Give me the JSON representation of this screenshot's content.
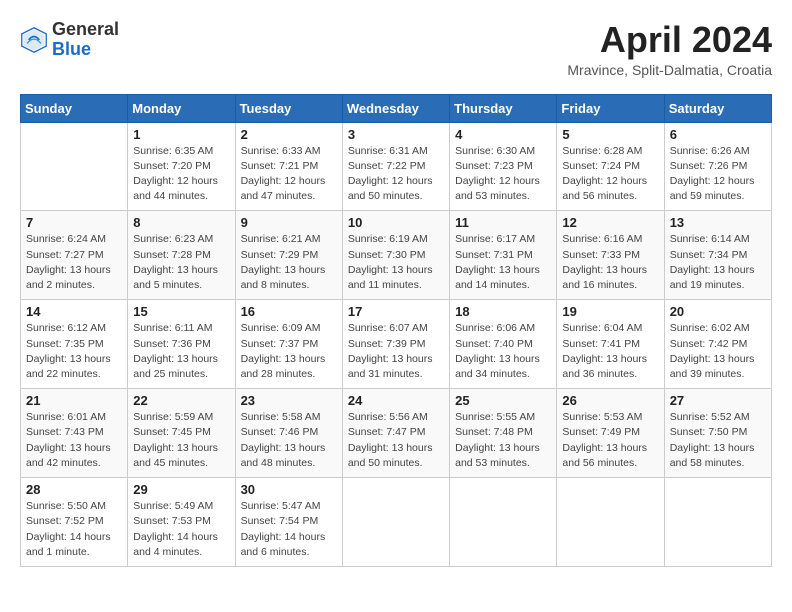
{
  "header": {
    "logo_general": "General",
    "logo_blue": "Blue",
    "month_title": "April 2024",
    "location": "Mravince, Split-Dalmatia, Croatia"
  },
  "weekdays": [
    "Sunday",
    "Monday",
    "Tuesday",
    "Wednesday",
    "Thursday",
    "Friday",
    "Saturday"
  ],
  "weeks": [
    [
      {
        "day": "",
        "info": ""
      },
      {
        "day": "1",
        "info": "Sunrise: 6:35 AM\nSunset: 7:20 PM\nDaylight: 12 hours\nand 44 minutes."
      },
      {
        "day": "2",
        "info": "Sunrise: 6:33 AM\nSunset: 7:21 PM\nDaylight: 12 hours\nand 47 minutes."
      },
      {
        "day": "3",
        "info": "Sunrise: 6:31 AM\nSunset: 7:22 PM\nDaylight: 12 hours\nand 50 minutes."
      },
      {
        "day": "4",
        "info": "Sunrise: 6:30 AM\nSunset: 7:23 PM\nDaylight: 12 hours\nand 53 minutes."
      },
      {
        "day": "5",
        "info": "Sunrise: 6:28 AM\nSunset: 7:24 PM\nDaylight: 12 hours\nand 56 minutes."
      },
      {
        "day": "6",
        "info": "Sunrise: 6:26 AM\nSunset: 7:26 PM\nDaylight: 12 hours\nand 59 minutes."
      }
    ],
    [
      {
        "day": "7",
        "info": "Sunrise: 6:24 AM\nSunset: 7:27 PM\nDaylight: 13 hours\nand 2 minutes."
      },
      {
        "day": "8",
        "info": "Sunrise: 6:23 AM\nSunset: 7:28 PM\nDaylight: 13 hours\nand 5 minutes."
      },
      {
        "day": "9",
        "info": "Sunrise: 6:21 AM\nSunset: 7:29 PM\nDaylight: 13 hours\nand 8 minutes."
      },
      {
        "day": "10",
        "info": "Sunrise: 6:19 AM\nSunset: 7:30 PM\nDaylight: 13 hours\nand 11 minutes."
      },
      {
        "day": "11",
        "info": "Sunrise: 6:17 AM\nSunset: 7:31 PM\nDaylight: 13 hours\nand 14 minutes."
      },
      {
        "day": "12",
        "info": "Sunrise: 6:16 AM\nSunset: 7:33 PM\nDaylight: 13 hours\nand 16 minutes."
      },
      {
        "day": "13",
        "info": "Sunrise: 6:14 AM\nSunset: 7:34 PM\nDaylight: 13 hours\nand 19 minutes."
      }
    ],
    [
      {
        "day": "14",
        "info": "Sunrise: 6:12 AM\nSunset: 7:35 PM\nDaylight: 13 hours\nand 22 minutes."
      },
      {
        "day": "15",
        "info": "Sunrise: 6:11 AM\nSunset: 7:36 PM\nDaylight: 13 hours\nand 25 minutes."
      },
      {
        "day": "16",
        "info": "Sunrise: 6:09 AM\nSunset: 7:37 PM\nDaylight: 13 hours\nand 28 minutes."
      },
      {
        "day": "17",
        "info": "Sunrise: 6:07 AM\nSunset: 7:39 PM\nDaylight: 13 hours\nand 31 minutes."
      },
      {
        "day": "18",
        "info": "Sunrise: 6:06 AM\nSunset: 7:40 PM\nDaylight: 13 hours\nand 34 minutes."
      },
      {
        "day": "19",
        "info": "Sunrise: 6:04 AM\nSunset: 7:41 PM\nDaylight: 13 hours\nand 36 minutes."
      },
      {
        "day": "20",
        "info": "Sunrise: 6:02 AM\nSunset: 7:42 PM\nDaylight: 13 hours\nand 39 minutes."
      }
    ],
    [
      {
        "day": "21",
        "info": "Sunrise: 6:01 AM\nSunset: 7:43 PM\nDaylight: 13 hours\nand 42 minutes."
      },
      {
        "day": "22",
        "info": "Sunrise: 5:59 AM\nSunset: 7:45 PM\nDaylight: 13 hours\nand 45 minutes."
      },
      {
        "day": "23",
        "info": "Sunrise: 5:58 AM\nSunset: 7:46 PM\nDaylight: 13 hours\nand 48 minutes."
      },
      {
        "day": "24",
        "info": "Sunrise: 5:56 AM\nSunset: 7:47 PM\nDaylight: 13 hours\nand 50 minutes."
      },
      {
        "day": "25",
        "info": "Sunrise: 5:55 AM\nSunset: 7:48 PM\nDaylight: 13 hours\nand 53 minutes."
      },
      {
        "day": "26",
        "info": "Sunrise: 5:53 AM\nSunset: 7:49 PM\nDaylight: 13 hours\nand 56 minutes."
      },
      {
        "day": "27",
        "info": "Sunrise: 5:52 AM\nSunset: 7:50 PM\nDaylight: 13 hours\nand 58 minutes."
      }
    ],
    [
      {
        "day": "28",
        "info": "Sunrise: 5:50 AM\nSunset: 7:52 PM\nDaylight: 14 hours\nand 1 minute."
      },
      {
        "day": "29",
        "info": "Sunrise: 5:49 AM\nSunset: 7:53 PM\nDaylight: 14 hours\nand 4 minutes."
      },
      {
        "day": "30",
        "info": "Sunrise: 5:47 AM\nSunset: 7:54 PM\nDaylight: 14 hours\nand 6 minutes."
      },
      {
        "day": "",
        "info": ""
      },
      {
        "day": "",
        "info": ""
      },
      {
        "day": "",
        "info": ""
      },
      {
        "day": "",
        "info": ""
      }
    ]
  ]
}
